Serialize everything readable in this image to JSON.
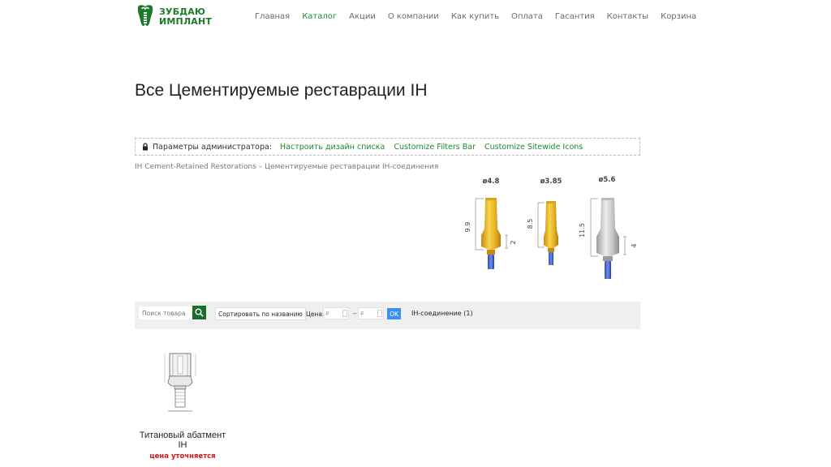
{
  "brand": {
    "line1": "ЗУБДАЮ",
    "line2": "ИМПЛАНТ",
    "accent": "#1e8a2e"
  },
  "nav": [
    {
      "label": "Главная",
      "active": false
    },
    {
      "label": "Каталог",
      "active": true
    },
    {
      "label": "Акции",
      "active": false
    },
    {
      "label": "О компании",
      "active": false
    },
    {
      "label": "Как купить",
      "active": false
    },
    {
      "label": "Оплата",
      "active": false
    },
    {
      "label": "Гасантия",
      "active": false
    },
    {
      "label": "Контакты",
      "active": false
    },
    {
      "label": "Корзина",
      "active": false
    }
  ],
  "page_title": "Все Цементируемые реставрации IH",
  "admin": {
    "label": "Параметры администратора:",
    "links": [
      "Настроить дизайн списка",
      "Customize Filters Bar",
      "Customize Sitewide Icons"
    ]
  },
  "subtitle": "IH Cement-Retained Restorations – Цементируемые реставрации IH-соединения",
  "diagram": {
    "items": [
      {
        "diameter": "ø4.8",
        "height": "9.9",
        "gingival": "2",
        "color": "gold"
      },
      {
        "diameter": "ø3.85",
        "height": "8.5",
        "gingival": "",
        "color": "gold"
      },
      {
        "diameter": "ø5.6",
        "height": "11.5",
        "gingival": "4",
        "color": "silver"
      }
    ]
  },
  "filters": {
    "search_placeholder": "Поиск товара",
    "sort_label": "Сортировать по названию",
    "price_label": "Цена:",
    "price_from_placeholder": "₽",
    "price_to_placeholder": "₽",
    "price_dash": "–",
    "ok_label": "OK",
    "connection_label": "IH-соединение (1)"
  },
  "product": {
    "name_line1": "Титановый абатмент",
    "name_line2": "IH",
    "price_text": "цена уточняется"
  }
}
